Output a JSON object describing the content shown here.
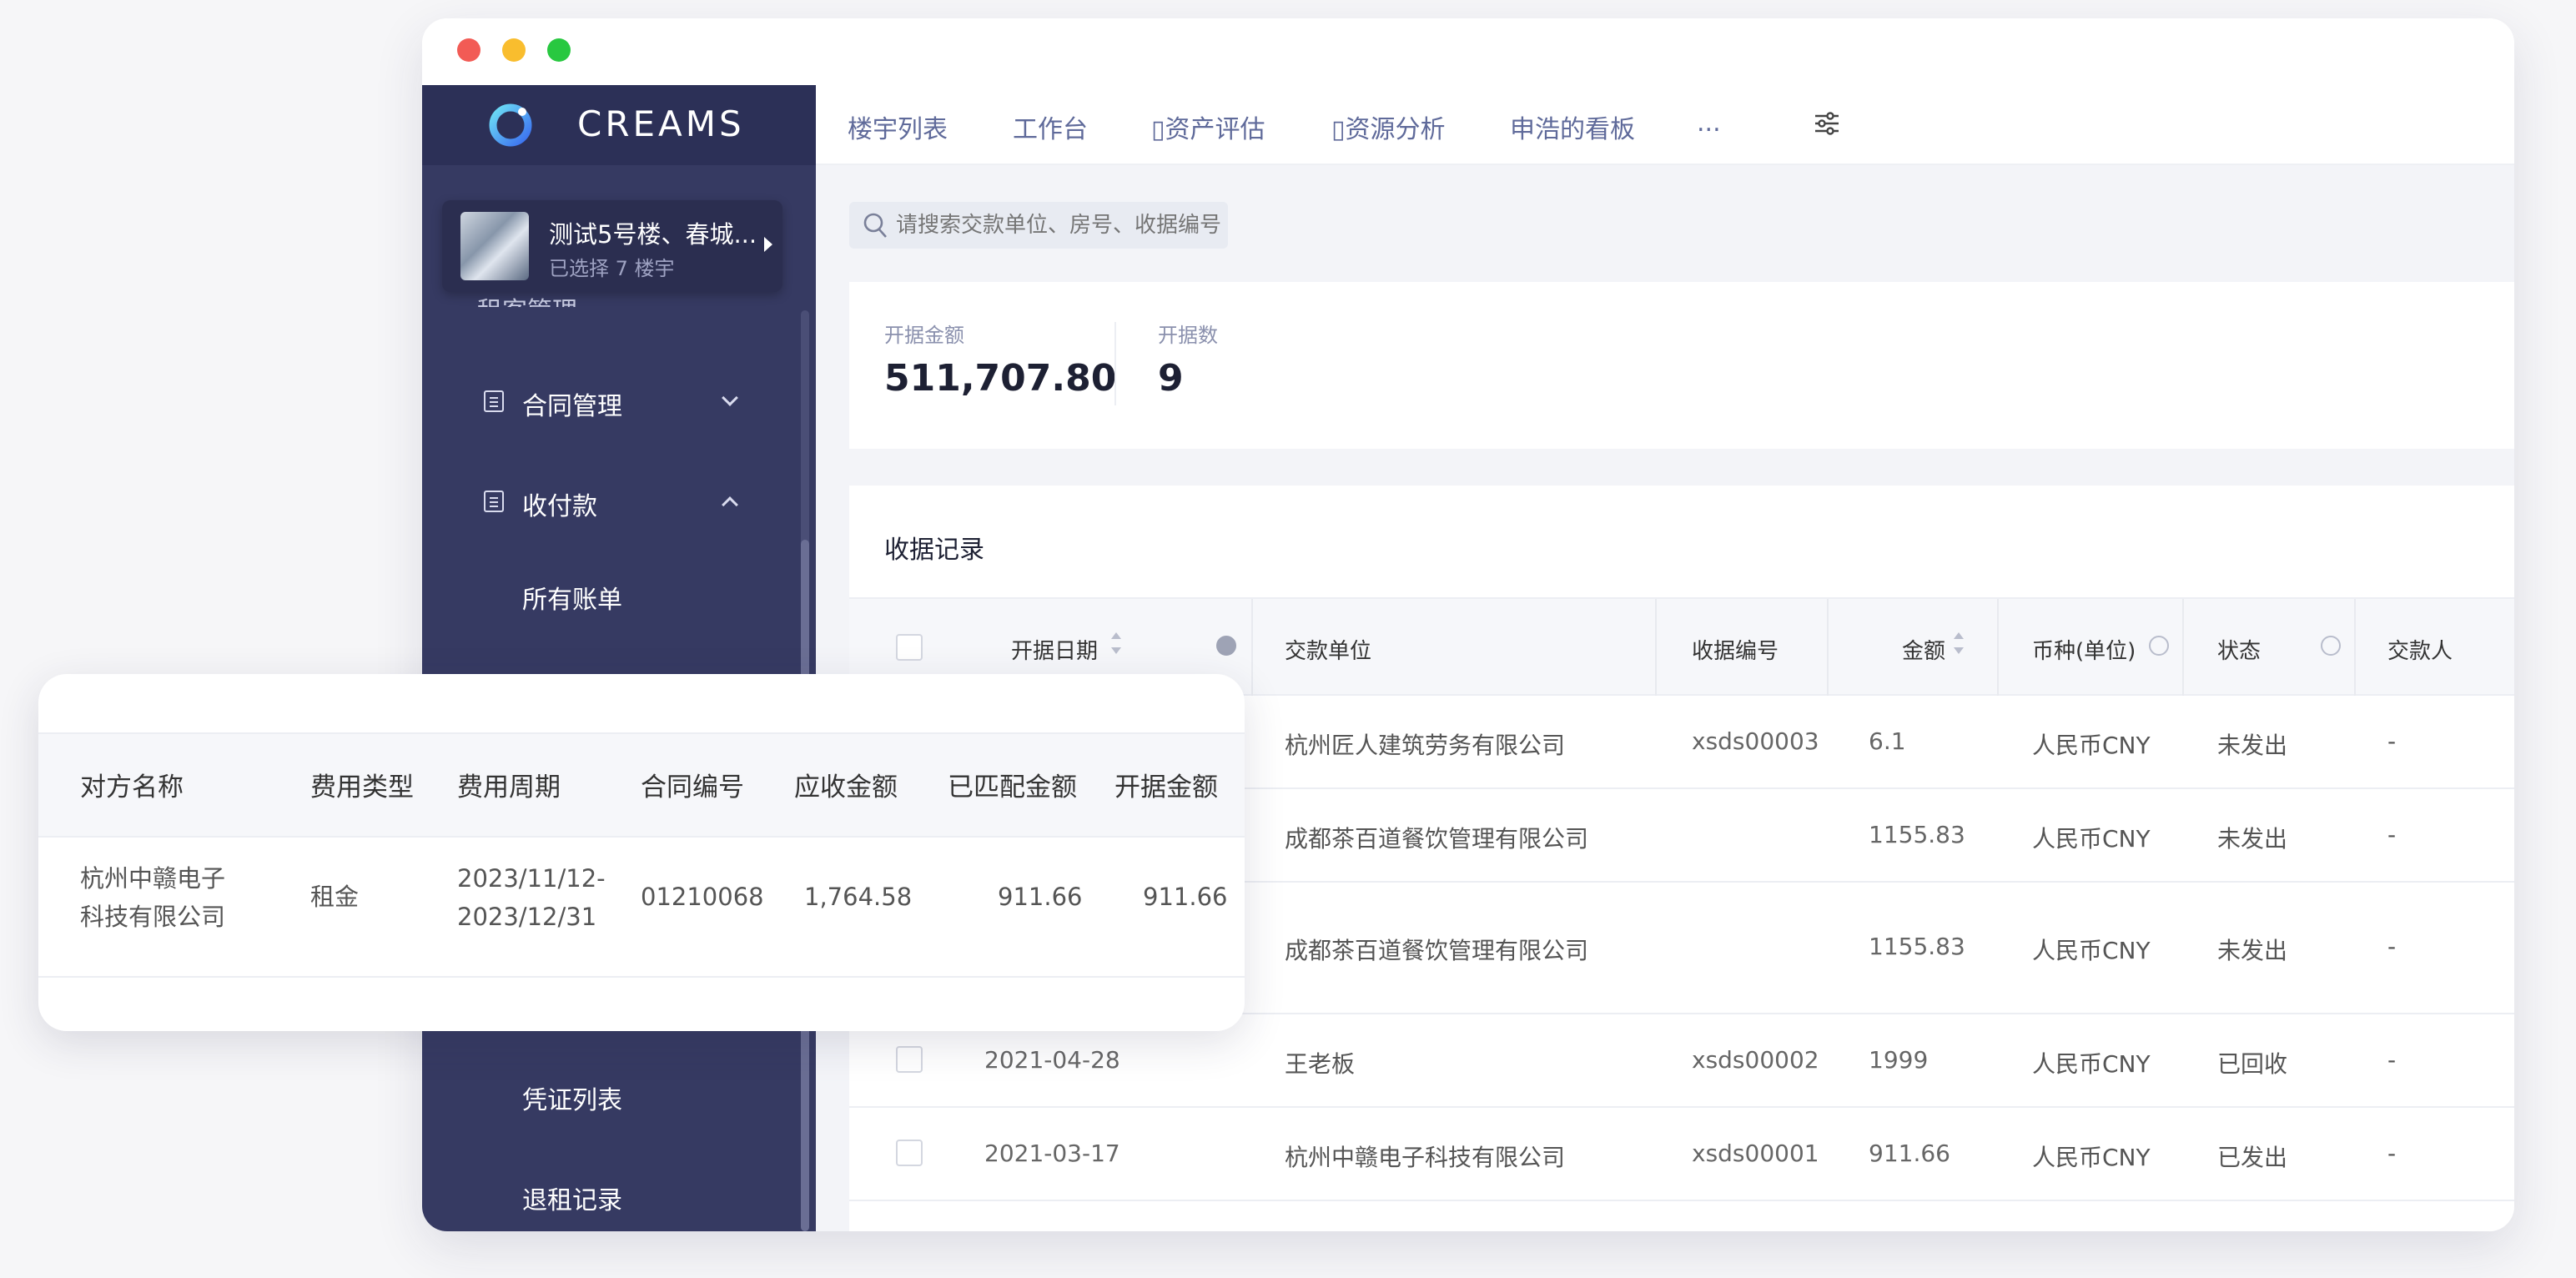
{
  "app": {
    "brand": "CREAMS"
  },
  "project": {
    "name": "测试5号楼、春城...",
    "subtitle": "已选择 7 楼宇"
  },
  "sidebar": {
    "peek_label": "租客管理",
    "items": [
      {
        "label": "合同管理",
        "expanded": false
      },
      {
        "label": "收付款",
        "expanded": true
      }
    ],
    "sub_items": [
      "所有账单",
      "凭证列表",
      "退租记录"
    ]
  },
  "nav": {
    "tabs": [
      "楼宇列表",
      "工作台",
      "▯资产评估",
      "▯资源分析",
      "申浩的看板",
      "..."
    ]
  },
  "search": {
    "placeholder": "请搜索交款单位、房号、收据编号"
  },
  "stats": [
    {
      "label": "开据金额",
      "value": "511,707.80"
    },
    {
      "label": "开据数",
      "value": "9"
    }
  ],
  "records": {
    "title": "收据记录",
    "columns": [
      "开据日期",
      "交款单位",
      "收据编号",
      "金额",
      "币种(单位)",
      "状态",
      "交款人"
    ],
    "rows": [
      {
        "date": "",
        "payer": "杭州匠人建筑劳务有限公司",
        "receipt_no": "xsds00003",
        "amount": "6.1",
        "currency": "人民币CNY",
        "status": "未发出",
        "person": "-"
      },
      {
        "date": "",
        "payer": "成都茶百道餐饮管理有限公司",
        "receipt_no": "",
        "amount": "1155.83",
        "currency": "人民币CNY",
        "status": "未发出",
        "person": "-"
      },
      {
        "date": "",
        "payer": "成都茶百道餐饮管理有限公司",
        "receipt_no": "",
        "amount": "1155.83",
        "currency": "人民币CNY",
        "status": "未发出",
        "person": "-"
      },
      {
        "date": "2021-04-28",
        "payer": "王老板",
        "receipt_no": "xsds00002",
        "amount": "1999",
        "currency": "人民币CNY",
        "status": "已回收",
        "person": "-"
      },
      {
        "date": "2021-03-17",
        "payer": "杭州中赣电子科技有限公司",
        "receipt_no": "xsds00001",
        "amount": "911.66",
        "currency": "人民币CNY",
        "status": "已发出",
        "person": "-"
      }
    ]
  },
  "overlay": {
    "columns": [
      "对方名称",
      "费用类型",
      "费用周期",
      "合同编号",
      "应收金额",
      "已匹配金额",
      "开据金额"
    ],
    "row": {
      "name_line1": "杭州中赣电子",
      "name_line2": "科技有限公司",
      "fee_type": "租金",
      "period_line1": "2023/11/12-",
      "period_line2": "2023/12/31",
      "contract_no": "01210068",
      "receivable": "1,764.58",
      "matched": "911.66",
      "invoiced": "911.66"
    }
  }
}
